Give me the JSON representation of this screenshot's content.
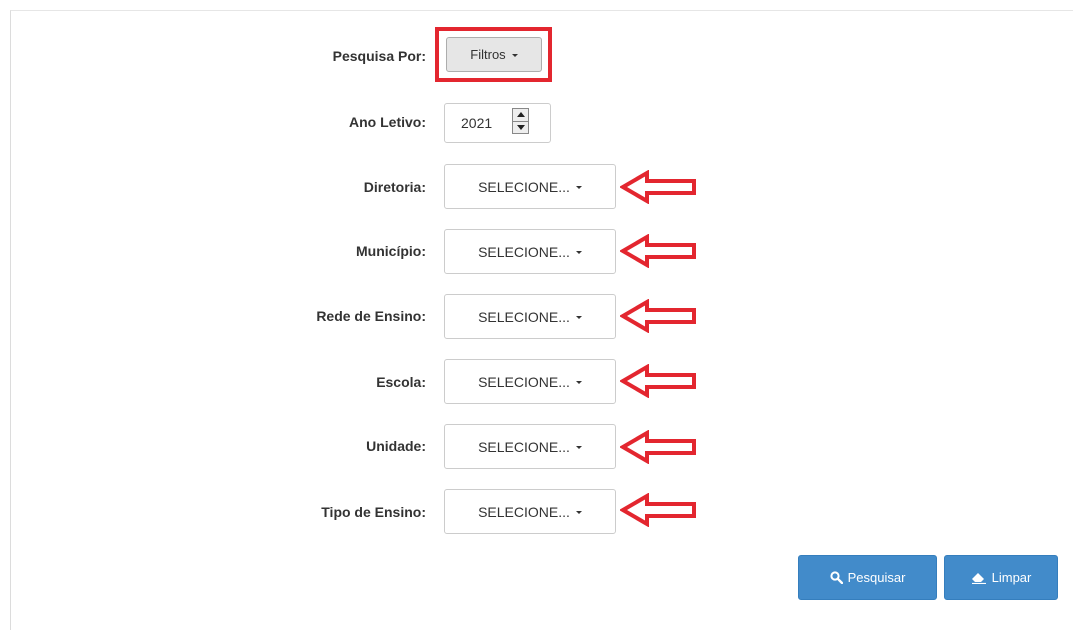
{
  "form": {
    "search_by": {
      "label": "Pesquisa Por:",
      "button_label": "Filtros"
    },
    "year": {
      "label": "Ano Letivo:",
      "value": "2021"
    },
    "fields": [
      {
        "label": "Diretoria:",
        "value": "SELECIONE..."
      },
      {
        "label": "Município:",
        "value": "SELECIONE..."
      },
      {
        "label": "Rede de Ensino:",
        "value": "SELECIONE..."
      },
      {
        "label": "Escola:",
        "value": "SELECIONE..."
      },
      {
        "label": "Unidade:",
        "value": "SELECIONE..."
      },
      {
        "label": "Tipo de Ensino:",
        "value": "SELECIONE..."
      }
    ]
  },
  "actions": {
    "search_label": "Pesquisar",
    "clear_label": "Limpar"
  },
  "icons": {
    "search": "search-icon",
    "clear": "eraser-icon",
    "annotation": "red-arrow-left-icon"
  },
  "colors": {
    "highlight": "#e3262f",
    "primary": "#428bca"
  }
}
